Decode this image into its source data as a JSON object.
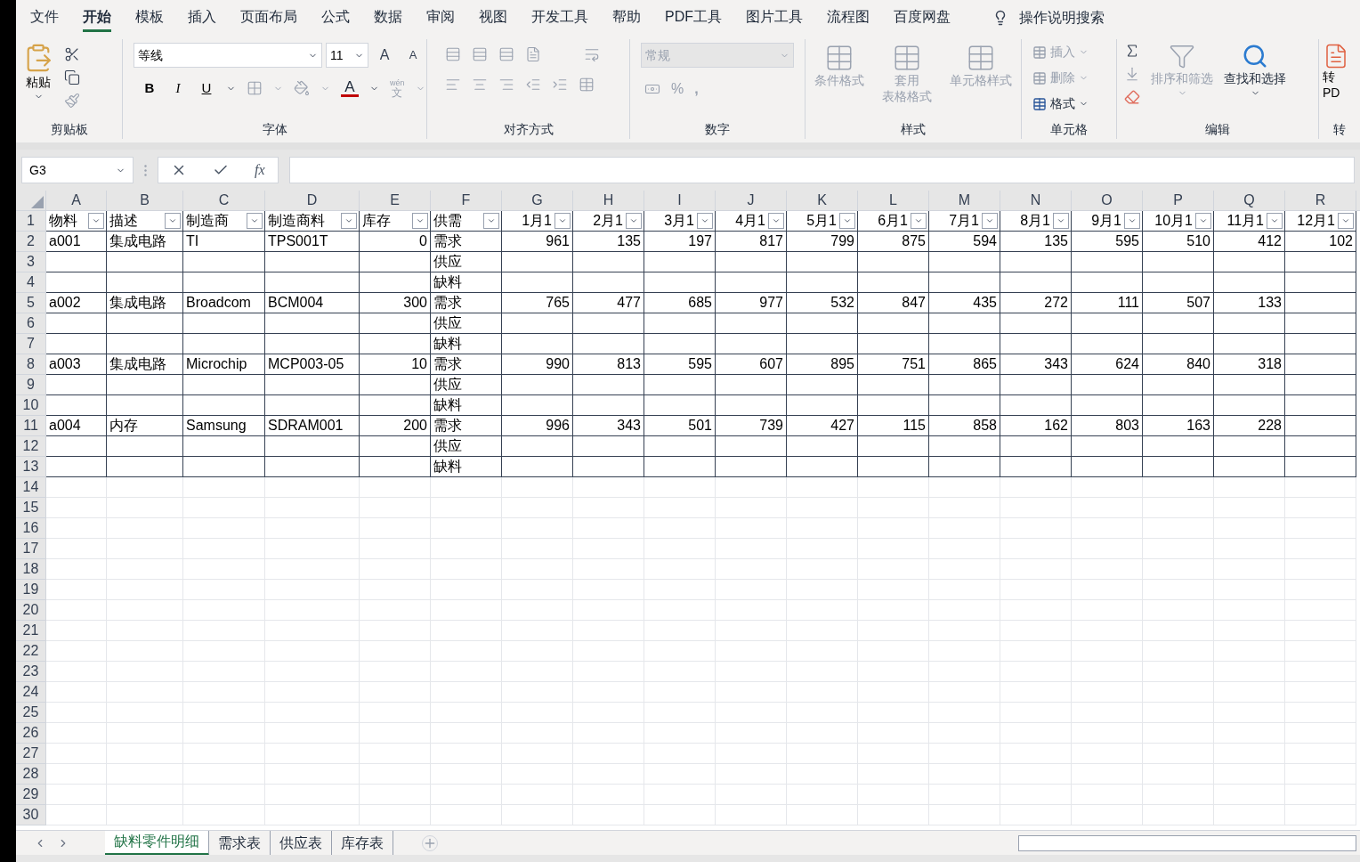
{
  "menu_tabs": [
    {
      "label": "文件",
      "selected": false
    },
    {
      "label": "开始",
      "selected": true
    },
    {
      "label": "模板",
      "selected": false
    },
    {
      "label": "插入",
      "selected": false
    },
    {
      "label": "页面布局",
      "selected": false
    },
    {
      "label": "公式",
      "selected": false
    },
    {
      "label": "数据",
      "selected": false
    },
    {
      "label": "审阅",
      "selected": false
    },
    {
      "label": "视图",
      "selected": false
    },
    {
      "label": "开发工具",
      "selected": false
    },
    {
      "label": "帮助",
      "selected": false
    },
    {
      "label": "PDF工具",
      "selected": false
    },
    {
      "label": "图片工具",
      "selected": false
    },
    {
      "label": "流程图",
      "selected": false
    },
    {
      "label": "百度网盘",
      "selected": false
    }
  ],
  "tell_me": "操作说明搜索",
  "ribbon": {
    "clipboard": {
      "label": "剪贴板",
      "paste": "粘贴"
    },
    "font": {
      "label": "字体",
      "font_name": "等线",
      "font_size": "11",
      "bold": "B",
      "italic": "I",
      "underline": "U",
      "font_color": "A",
      "grow": "A",
      "shrink": "A",
      "phonetic_top": "wén",
      "phonetic_bottom": "文"
    },
    "alignment": {
      "label": "对齐方式"
    },
    "number": {
      "label": "数字",
      "format": "常规",
      "format_disabled": true,
      "percent": "%",
      "comma": ","
    },
    "styles": {
      "label": "样式",
      "buttons": [
        {
          "label": "条件格式",
          "disabled": true
        },
        {
          "label": "套用",
          "label2": "表格格式",
          "disabled": true
        },
        {
          "label": "单元格样式",
          "disabled": true
        }
      ]
    },
    "cells": {
      "label": "单元格",
      "buttons": [
        {
          "label": "插入",
          "disabled": true
        },
        {
          "label": "删除",
          "disabled": true
        },
        {
          "label": "格式",
          "disabled": false
        }
      ]
    },
    "editing": {
      "label": "编辑",
      "buttons": [
        {
          "label": "排序和筛选",
          "disabled": true
        },
        {
          "label": "查找和选择",
          "disabled": false
        }
      ]
    },
    "convert": {
      "label": "转",
      "button": "转",
      "button2": "PD"
    }
  },
  "formula_bar": {
    "name_box": "G3",
    "function_label": "fx"
  },
  "columns": [
    "A",
    "B",
    "C",
    "D",
    "E",
    "F",
    "G",
    "H",
    "I",
    "J",
    "K",
    "L",
    "M",
    "N",
    "O",
    "P",
    "Q",
    "R"
  ],
  "rows": [
    {
      "number": "1",
      "kind": "header",
      "cells": {
        "A": "物料",
        "B": "描述",
        "C": "制造商",
        "D": "制造商料",
        "E": "库存",
        "F": "供需",
        "G": "1月1",
        "H": "2月1",
        "I": "3月1",
        "J": "4月1",
        "K": "5月1",
        "L": "6月1",
        "M": "7月1",
        "N": "8月1",
        "O": "9月1",
        "P": "10月1",
        "Q": "11月1",
        "R": "12月1"
      }
    },
    {
      "number": "2",
      "kind": "data",
      "cells": {
        "A": "a001",
        "B": "集成电路",
        "C": "TI",
        "D": "TPS001T",
        "E": "0",
        "F": "需求",
        "G": "961",
        "H": "135",
        "I": "197",
        "J": "817",
        "K": "799",
        "L": "875",
        "M": "594",
        "N": "135",
        "O": "595",
        "P": "510",
        "Q": "412",
        "R": "102"
      }
    },
    {
      "number": "3",
      "kind": "data",
      "cells": {
        "F": "供应"
      }
    },
    {
      "number": "4",
      "kind": "data",
      "cells": {
        "F": "缺料"
      }
    },
    {
      "number": "5",
      "kind": "data",
      "cells": {
        "A": "a002",
        "B": "集成电路",
        "C": "Broadcom",
        "D": "BCM004",
        "E": "300",
        "F": "需求",
        "G": "765",
        "H": "477",
        "I": "685",
        "J": "977",
        "K": "532",
        "L": "847",
        "M": "435",
        "N": "272",
        "O": "111",
        "P": "507",
        "Q": "133"
      }
    },
    {
      "number": "6",
      "kind": "data",
      "cells": {
        "F": "供应"
      }
    },
    {
      "number": "7",
      "kind": "data",
      "cells": {
        "F": "缺料"
      }
    },
    {
      "number": "8",
      "kind": "data",
      "cells": {
        "A": "a003",
        "B": "集成电路",
        "C": "Microchip",
        "D": "MCP003-05",
        "E": "10",
        "F": "需求",
        "G": "990",
        "H": "813",
        "I": "595",
        "J": "607",
        "K": "895",
        "L": "751",
        "M": "865",
        "N": "343",
        "O": "624",
        "P": "840",
        "Q": "318"
      }
    },
    {
      "number": "9",
      "kind": "data",
      "cells": {
        "F": "供应"
      }
    },
    {
      "number": "10",
      "kind": "data",
      "cells": {
        "F": "缺料"
      }
    },
    {
      "number": "11",
      "kind": "data",
      "cells": {
        "A": "a004",
        "B": "内存",
        "C": "Samsung",
        "D": "SDRAM001",
        "E": "200",
        "F": "需求",
        "G": "996",
        "H": "343",
        "I": "501",
        "J": "739",
        "K": "427",
        "L": "115",
        "M": "858",
        "N": "162",
        "O": "803",
        "P": "163",
        "Q": "228"
      }
    },
    {
      "number": "12",
      "kind": "data",
      "cells": {
        "F": "供应"
      }
    },
    {
      "number": "13",
      "kind": "data",
      "cells": {
        "F": "缺料"
      }
    },
    {
      "number": "14",
      "kind": "blank",
      "cells": {}
    },
    {
      "number": "15",
      "kind": "blank",
      "cells": {}
    },
    {
      "number": "16",
      "kind": "blank",
      "cells": {}
    },
    {
      "number": "17",
      "kind": "blank",
      "cells": {}
    },
    {
      "number": "18",
      "kind": "blank",
      "cells": {}
    },
    {
      "number": "19",
      "kind": "blank",
      "cells": {}
    },
    {
      "number": "20",
      "kind": "blank",
      "cells": {}
    },
    {
      "number": "21",
      "kind": "blank",
      "cells": {}
    },
    {
      "number": "22",
      "kind": "blank",
      "cells": {}
    },
    {
      "number": "23",
      "kind": "blank",
      "cells": {}
    },
    {
      "number": "24",
      "kind": "blank",
      "cells": {}
    },
    {
      "number": "25",
      "kind": "blank",
      "cells": {}
    },
    {
      "number": "26",
      "kind": "blank",
      "cells": {}
    },
    {
      "number": "27",
      "kind": "blank",
      "cells": {}
    },
    {
      "number": "28",
      "kind": "blank",
      "cells": {}
    },
    {
      "number": "29",
      "kind": "blank",
      "cells": {}
    },
    {
      "number": "30",
      "kind": "blank",
      "cells": {}
    }
  ],
  "sheet_tabs": [
    {
      "label": "缺料零件明细",
      "selected": true
    },
    {
      "label": "需求表",
      "selected": false
    },
    {
      "label": "供应表",
      "selected": false
    },
    {
      "label": "库存表",
      "selected": false
    }
  ]
}
